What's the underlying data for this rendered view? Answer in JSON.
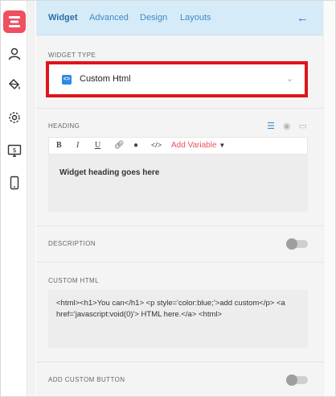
{
  "tabs": {
    "widget": "Widget",
    "advanced": "Advanced",
    "design": "Design",
    "layouts": "Layouts"
  },
  "back_icon": "←",
  "rail": {
    "items": [
      "widget-icon",
      "user-icon",
      "paint-bucket-icon",
      "gear-icon",
      "money-screen-icon",
      "mobile-icon"
    ],
    "accent": "#ef4f5f"
  },
  "widget_type": {
    "label": "WIDGET TYPE",
    "selected": "Custom Html",
    "icon_glyph": "<>"
  },
  "heading": {
    "label": "HEADING",
    "toolbar": {
      "bold": "B",
      "italic": "I",
      "underline": "U",
      "add_variable": "Add Variable"
    },
    "value": "Widget heading goes here"
  },
  "description": {
    "label": "DESCRIPTION",
    "enabled": false
  },
  "custom_html": {
    "label": "CUSTOM HTML",
    "value": "<html><h1>You can</h1> <p style='color:blue;'>add custom</p> <a href='javascript:void(0)'> HTML here.</a> <html>"
  },
  "custom_button": {
    "label": "ADD CUSTOM BUTTON",
    "enabled": false
  },
  "colors": {
    "header_bg": "#d6ebf8",
    "tab_text": "#3d8bc6",
    "highlight_border": "#e0141b"
  }
}
